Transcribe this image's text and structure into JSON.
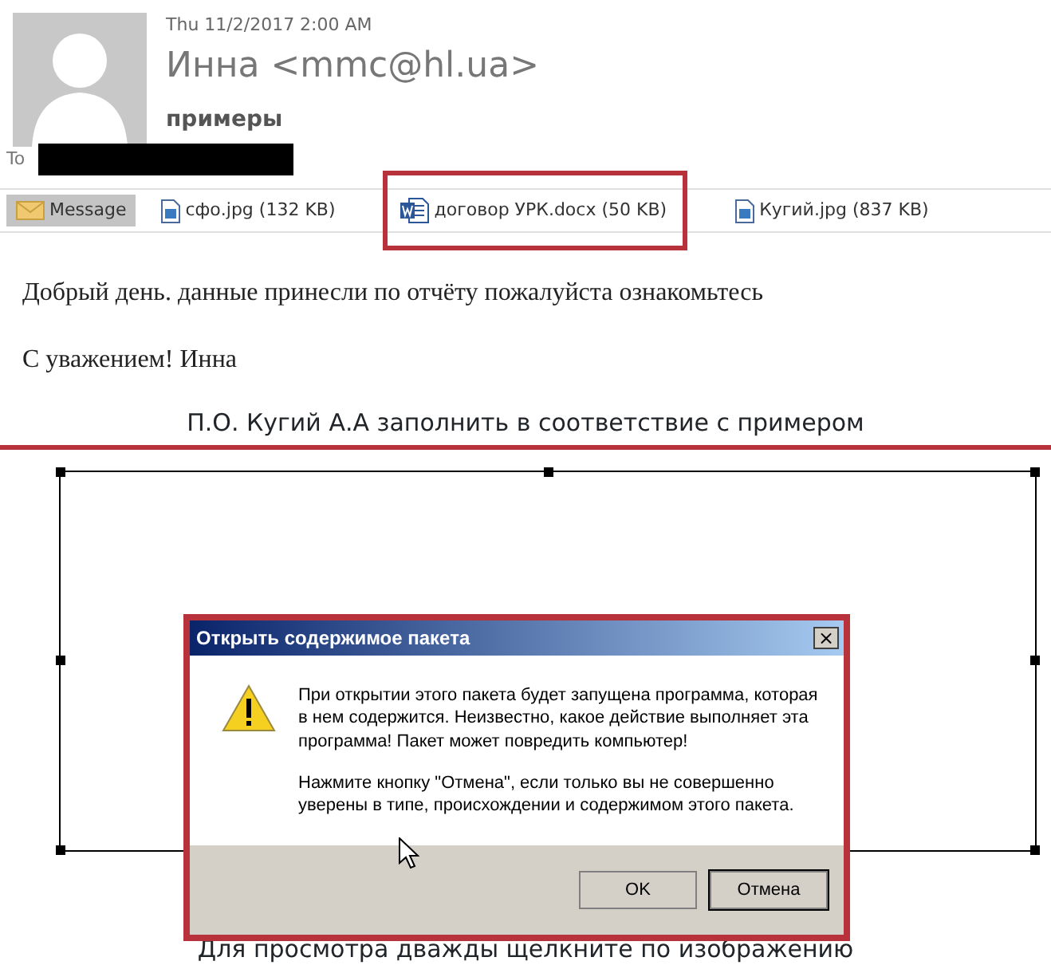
{
  "message": {
    "date": "Thu 11/2/2017 2:00 AM",
    "sender": "Инна <mmc@hl.ua>",
    "subject": "примеры",
    "to_label": "To"
  },
  "attachments": [
    {
      "kind": "message",
      "label": "Message",
      "selected": true,
      "highlighted": false
    },
    {
      "kind": "image",
      "label": "сфо.jpg (132 KB)",
      "selected": false,
      "highlighted": false
    },
    {
      "kind": "word",
      "label": "договор УРК.docx (50 KB)",
      "selected": false,
      "highlighted": true
    },
    {
      "kind": "image",
      "label": "Кугий.jpg (837 KB)",
      "selected": false,
      "highlighted": false
    }
  ],
  "body": [
    "Добрый день. данные принесли по отчёту пожалуйста ознакомьтесь",
    "С уважением! Инна"
  ],
  "caption": "П.О. Кугий А.А заполнить в соответствие с примером",
  "object_caption": "Для просмотра дважды щелкните по изображению",
  "dialog": {
    "title": "Открыть содержимое пакета",
    "close": "×",
    "paragraphs": [
      "При открытии этого пакета будет запущена программа, которая в нем содержится. Неизвестно, какое действие выполняет эта программа!  Пакет может повредить компьютер!",
      "Нажмите кнопку \"Отмена\", если только вы не совершенно уверены в типе, происхождении и содержимом этого пакета."
    ],
    "buttons": [
      {
        "label": "OK",
        "default": false
      },
      {
        "label": "Отмена",
        "default": true
      }
    ]
  }
}
